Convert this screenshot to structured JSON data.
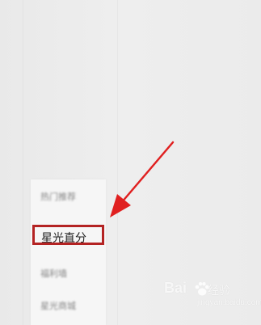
{
  "menu": {
    "items": [
      {
        "label": "热门推荐"
      },
      {
        "label": "星光直分"
      },
      {
        "label": "福利墙"
      },
      {
        "label": "星光商城"
      }
    ],
    "highlighted_item": "星光直分"
  },
  "annotation": {
    "arrow_color": "#e02020",
    "box_color": "#b42323"
  },
  "watermark": {
    "brand": "Bai",
    "paw_icon": "baidu-paw-icon",
    "suffix": "经验",
    "url": "jingyan.baidu.com"
  }
}
